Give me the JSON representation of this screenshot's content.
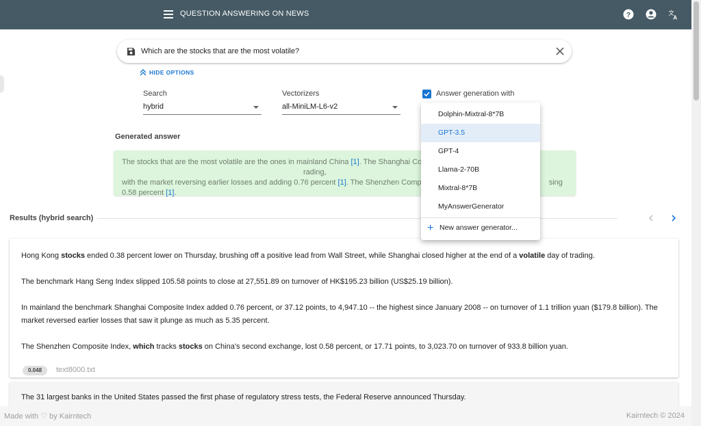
{
  "header": {
    "title": "QUESTION ANSWERING ON NEWS",
    "icons": [
      "menu-icon",
      "help-icon",
      "account-icon",
      "translate-icon"
    ]
  },
  "search": {
    "query": "Which are the stocks that are the most volatile?",
    "hide_options_label": "HIDE OPTIONS"
  },
  "options": {
    "search_label": "Search",
    "search_value": "hybrid",
    "vectorizers_label": "Vectorizers",
    "vectorizers_value": "all-MiniLM-L6-v2",
    "answer_generation_label": "Answer generation with",
    "answer_generation_checked": true
  },
  "dropdown": {
    "items": [
      "Dolphin-Mixtral-8*7B",
      "GPT-3.5",
      "GPT-4",
      "Llama-2-70B",
      "Mixtral-8*7B",
      "MyAnswerGenerator"
    ],
    "selected": "GPT-3.5",
    "new_item_label": "New answer generator..."
  },
  "generated": {
    "title": "Generated answer",
    "seg1": "The stocks that are the most volatile are the ones in mainland China ",
    "cite1": "[1]",
    "seg2": ". The Shanghai Cor",
    "seg3": "rading,",
    "seg4": "with the market reversing earlier losses and adding 0.76 percent ",
    "cite2": "[1]",
    "seg5": ". The Shenzhen Compo",
    "seg6": "sing",
    "seg7": "0.58 percent ",
    "cite3": "[1]",
    "seg8": "."
  },
  "results": {
    "title": "Results (hybrid search)",
    "card1": {
      "p1_a": "Hong Kong ",
      "p1_b": "stocks",
      "p1_c": " ended 0.38 percent lower on Thursday, brushing off a positive lead from Wall Street, while Shanghai closed higher at the end of a ",
      "p1_d": "volatile",
      "p1_e": " day of trading.",
      "p2": "The benchmark Hang Seng Index slipped 105.58 points to close at 27,551.89 on turnover of HK$195.23 billion (US$25.19 billion).",
      "p3": "In mainland the benchmark Shanghai Composite Index added 0.76 percent, or 37.12 points, to 4,947.10 -- the highest since January 2008 -- on turnover of 1.1 trillion yuan ($179.8 billion). The market reversed earlier losses that saw it plunge as much as 5.35 percent.",
      "p4_a": "The Shenzhen Composite Index, ",
      "p4_b": "which",
      "p4_c": " tracks ",
      "p4_d": "stocks",
      "p4_e": " on China's second exchange, lost 0.58 percent, or 17.71 points, to 3,023.70 on turnover of 933.8 billion yuan.",
      "score": "0.048",
      "file": "text8000.txt"
    },
    "card2": {
      "p1": "The 31 largest banks in the United States passed the first phase of regulatory stress tests, the Federal Reserve announced Thursday."
    }
  },
  "footer": {
    "left": "Made with ♡ by Kairntech",
    "right": "Kairntech © 2024"
  },
  "colors": {
    "header_bg": "#455a64",
    "accent": "#1976d2",
    "answer_bg": "#dcf5dc"
  }
}
